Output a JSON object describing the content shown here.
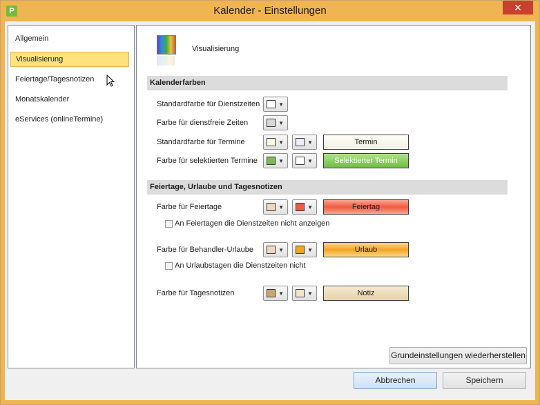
{
  "window": {
    "title": "Kalender - Einstellungen",
    "app_icon": "P",
    "close_glyph": "✕"
  },
  "nav": {
    "items": [
      {
        "label": "Allgemein"
      },
      {
        "label": "Visualisierung"
      },
      {
        "label": "Feiertage/Tagesnotizen"
      },
      {
        "label": "Monatskalender"
      },
      {
        "label": "eServices (onlineTermine)"
      }
    ]
  },
  "panel": {
    "header": "Visualisierung",
    "section1": "Kalenderfarben",
    "row1": {
      "label": "Standardfarbe für Dienstzeiten",
      "c1": "#ffffff"
    },
    "row2": {
      "label": "Farbe für dienstfreie Zeiten",
      "c1": "#d8d8d8"
    },
    "row3": {
      "label": "Standardfarbe für Termine",
      "c1": "#fffbe0",
      "c2": "#eeeef8",
      "preview": "Termin"
    },
    "row4": {
      "label": "Farbe für selektierten Termine",
      "c1": "#79bd4c",
      "c2": "#ffffff",
      "preview": "Selektierter Termin"
    },
    "section2": "Feiertage, Urlaube und Tagesnotizen",
    "row5": {
      "label": "Farbe für Feiertage",
      "c1": "#f2d7bd",
      "c2": "#f05a43",
      "preview": "Feiertag"
    },
    "check1": "An Feiertagen die Dienstzeiten nicht anzeigen",
    "row6": {
      "label": "Farbe für Behandler-Urlaube",
      "c1": "#f2d7bd",
      "c2": "#f5a422",
      "preview": "Urlaub"
    },
    "check2": "An Urlaubstagen die Dienstzeiten nicht",
    "row7": {
      "label": "Farbe für Tagesnotizen",
      "c1": "#c9a866",
      "c2": "#f4e4c8",
      "preview": "Notiz"
    },
    "reset_button": "Grundeinstellungen wiederherstellen"
  },
  "buttons": {
    "cancel": "Abbrechen",
    "save": "Speichern"
  },
  "colors": {
    "title_bar": "#f0b451",
    "selected_item": "#ffe27c",
    "close": "#c7412e"
  }
}
